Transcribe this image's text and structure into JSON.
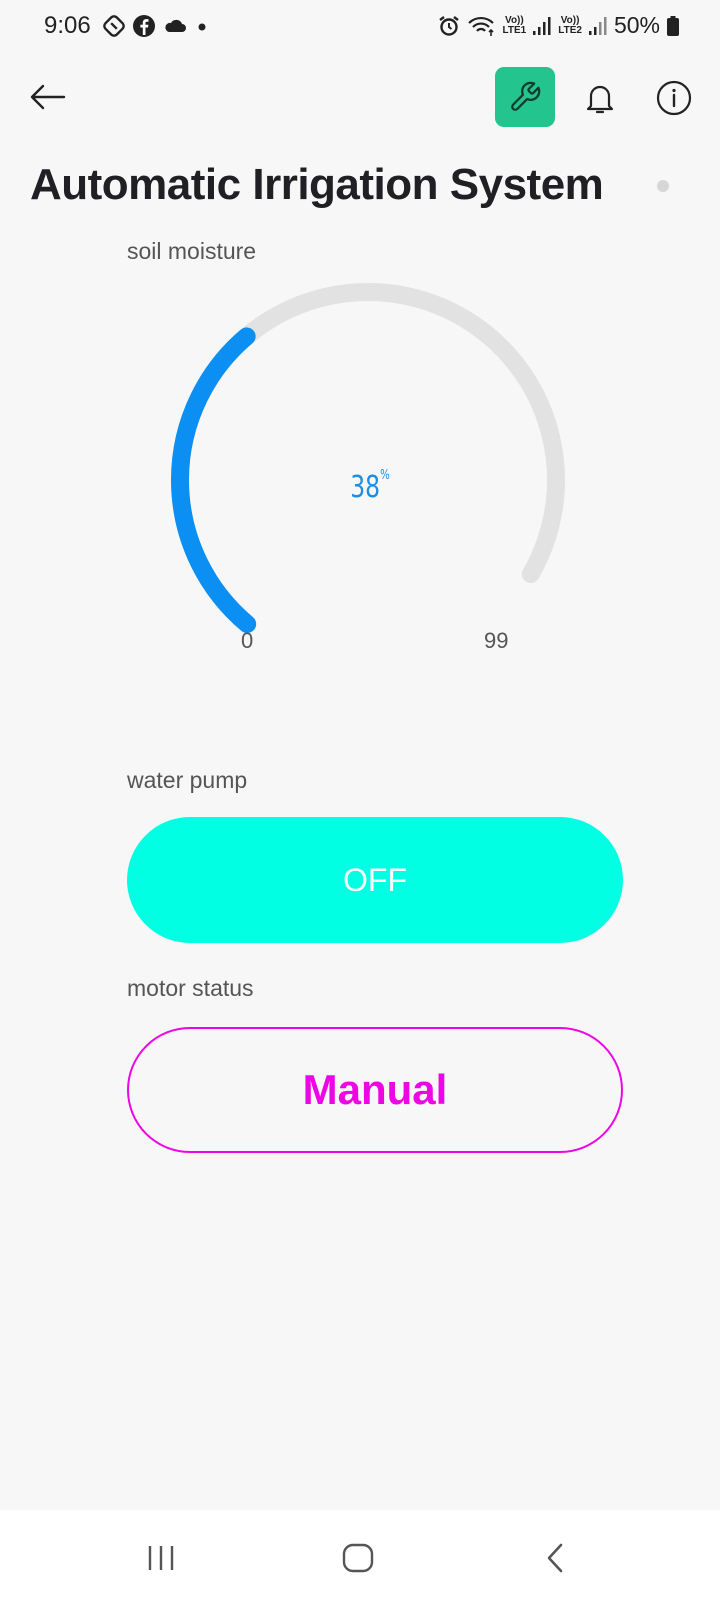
{
  "status_bar": {
    "time": "9:06",
    "battery": "50%",
    "sim1": "LTE1",
    "sim2": "LTE2",
    "volte": "Vo))"
  },
  "header": {
    "title": "Automatic Irrigation System",
    "accent_color": "#23c48e"
  },
  "soil_moisture": {
    "label": "soil moisture",
    "value": 38,
    "value_text": "38",
    "unit": "%",
    "min": 0,
    "max": 99,
    "min_label": "0",
    "max_label": "99",
    "fill_color": "#0b8ff2",
    "track_color": "#e2e2e2"
  },
  "water_pump": {
    "label": "water pump",
    "state": "OFF",
    "color": "#00ffe3"
  },
  "motor_status": {
    "label": "motor status",
    "value": "Manual",
    "color": "#ee05e6"
  },
  "icons": [
    "back-arrow-icon",
    "wrench-icon",
    "bell-icon",
    "info-icon",
    "recents-icon",
    "home-icon",
    "back-icon"
  ]
}
